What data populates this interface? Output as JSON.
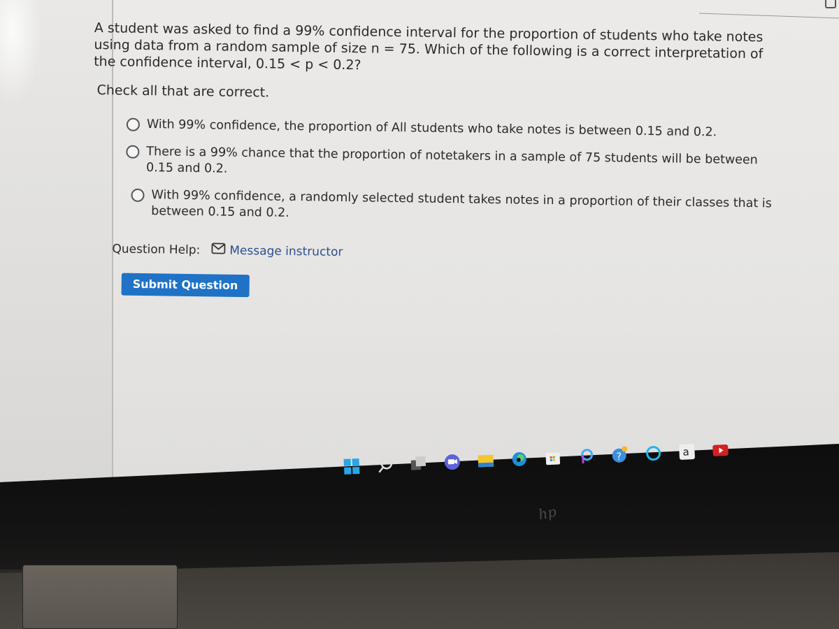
{
  "question": {
    "text": "A student was asked to find a 99% confidence interval for the proportion of students who take notes using data from a random sample of size n = 75. Which of the following is a correct interpretation of the confidence interval, 0.15 < p < 0.2?",
    "instruction": "Check all that are correct."
  },
  "options": [
    {
      "label": "With 99% confidence, the proportion of All students who take notes is between 0.15 and 0.2.",
      "selected": false
    },
    {
      "label": "There is a 99% chance that the proportion of notetakers in a sample of 75 students will be between 0.15 and 0.2.",
      "selected": false
    },
    {
      "label": "With 99% confidence, a randomly selected student takes notes in a proportion of their classes that is between 0.15 and 0.2.",
      "selected": false
    }
  ],
  "help": {
    "label": "Question Help:",
    "link_label": "Message instructor",
    "link_icon": "mail-icon"
  },
  "submit_label": "Submit Question",
  "colors": {
    "accent": "#1f72c6",
    "link": "#2d4f8f"
  },
  "taskbar": {
    "icons": [
      "windows-start-icon",
      "search-icon",
      "task-view-icon",
      "teams-chat-icon",
      "file-explorer-icon",
      "edge-browser-icon",
      "microsoft-store-icon",
      "picsart-icon",
      "help-icon",
      "alexa-icon",
      "amazon-icon",
      "youtube-icon"
    ]
  },
  "brand": "hp"
}
